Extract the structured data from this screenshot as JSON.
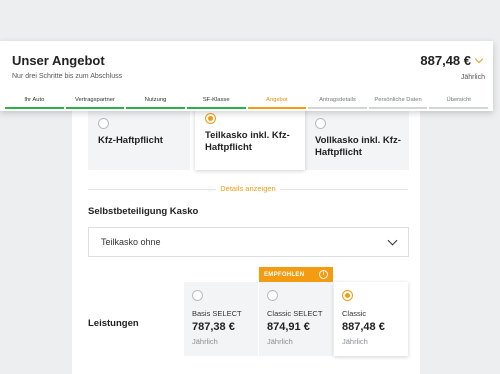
{
  "header": {
    "title": "Unser Angebot",
    "subtitle": "Nur drei Schritte bis zum Abschluss",
    "price": "887,48 €",
    "period": "Jährlich",
    "steps": [
      {
        "label": "Ihr Auto",
        "state": "done"
      },
      {
        "label": "Vertragspartner",
        "state": "done"
      },
      {
        "label": "Nutzung",
        "state": "done"
      },
      {
        "label": "SF-Klasse",
        "state": "done"
      },
      {
        "label": "Angebot",
        "state": "active"
      },
      {
        "label": "Antragsdetails",
        "state": "pending"
      },
      {
        "label": "Persönliche Daten",
        "state": "pending"
      },
      {
        "label": "Übersicht",
        "state": "pending"
      }
    ]
  },
  "coverage": {
    "options": [
      {
        "label": "Kfz-Haftpflicht",
        "selected": false
      },
      {
        "label": "Teilkasko inkl. Kfz-Haftpflicht",
        "selected": true
      },
      {
        "label": "Vollkasko inkl. Kfz-Haftpflicht",
        "selected": false
      }
    ],
    "details_link": "Details anzeigen"
  },
  "deductible": {
    "title": "Selbstbeteiligung Kasko",
    "value": "Teilkasko ohne"
  },
  "plans": {
    "section_label": "Leistungen",
    "badge": "EMPFOHLEN",
    "items": [
      {
        "name": "Basis SELECT",
        "price": "787,38 €",
        "period": "Jährlich",
        "selected": false
      },
      {
        "name": "Classic SELECT",
        "price": "874,91 €",
        "period": "Jährlich",
        "selected": false
      },
      {
        "name": "Classic",
        "price": "887,48 €",
        "period": "Jährlich",
        "selected": true
      }
    ]
  },
  "colors": {
    "accent": "#f39c12",
    "done": "#2db04b",
    "pending": "#d3d6d9"
  }
}
